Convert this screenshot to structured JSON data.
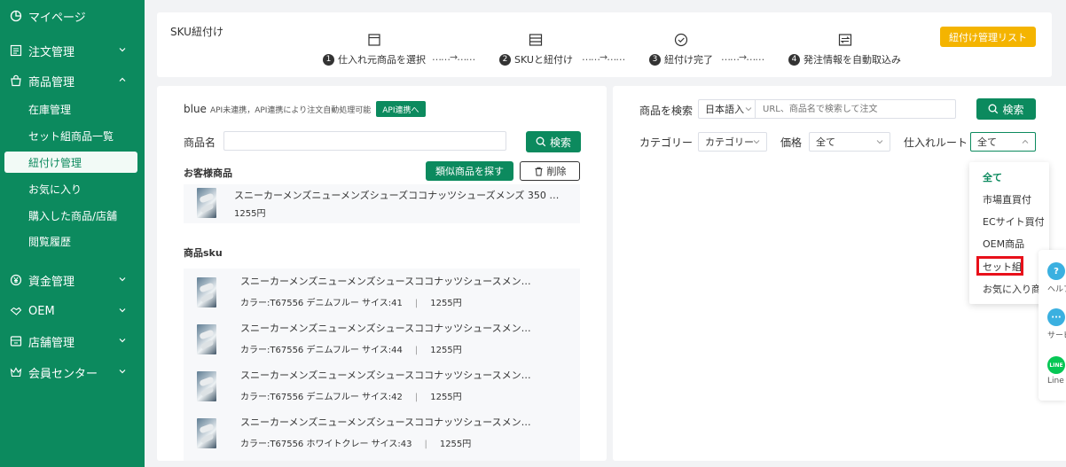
{
  "sidebar": {
    "items": [
      {
        "label": "マイページ",
        "icon": "pie-chart-icon"
      },
      {
        "label": "注文管理",
        "icon": "order-list-icon"
      },
      {
        "label": "商品管理",
        "icon": "bag-icon"
      },
      {
        "label": "資金管理",
        "icon": "yen-icon"
      },
      {
        "label": "OEM",
        "icon": "handshake-icon"
      },
      {
        "label": "店舗管理",
        "icon": "store-icon"
      },
      {
        "label": "会員センター",
        "icon": "crown-icon"
      }
    ],
    "sub_items": [
      "在庫管理",
      "セット組商品一覧",
      "紐付け管理",
      "お気に入り",
      "購入した商品/店舗",
      "閲覧履歴"
    ],
    "active_sub": "紐付け管理"
  },
  "steps": {
    "title": "SKU紐付け",
    "items": [
      {
        "num": "1",
        "label": "仕入れ元商品を選択",
        "icon": "window-icon"
      },
      {
        "num": "2",
        "label": "SKUと紐付け",
        "icon": "list-icon"
      },
      {
        "num": "3",
        "label": "紐付け完了",
        "icon": "check-circle-icon"
      },
      {
        "num": "4",
        "label": "発注情報を自動取込み",
        "icon": "transfer-icon"
      }
    ],
    "arrow": "……→……",
    "manage_button": "紐付け管理リスト"
  },
  "left": {
    "brand": "blue",
    "api_note": "API未連携，API連携により注文自動処理可能",
    "api_button": "API連携へ",
    "product_name_label": "商品名",
    "search_button": "検索",
    "customer_section": "お客様商品",
    "similar_button": "類似商品を探す",
    "delete_button": "削除",
    "customer_item": {
      "title": "スニーカーメンズニューメンズシューズココナッツシューズメンズ 350 …",
      "price": "1255円"
    },
    "sku_section": "商品sku",
    "sku_items": [
      {
        "title": "スニーカーメンズニューメンズシュースココナッツシュースメン…",
        "spec": "カラー:T67556 デニムフルー サイス:41",
        "price": "1255円"
      },
      {
        "title": "スニーカーメンズニューメンズシュースココナッツシュースメン…",
        "spec": "カラー:T67556 デニムフルー サイス:44",
        "price": "1255円"
      },
      {
        "title": "スニーカーメンズニューメンズシュースココナッツシュースメン…",
        "spec": "カラー:T67556 デニムフルー サイス:42",
        "price": "1255円"
      },
      {
        "title": "スニーカーメンズニューメンズシュースココナッツシュースメン…",
        "spec": "カラー:T67556 ホワイトクレー サイス:43",
        "price": "1255円"
      }
    ]
  },
  "right": {
    "search_label": "商品を検索",
    "lang_select": "日本語入",
    "search_placeholder": "URL、商品名で検索して注文",
    "search_button": "検索",
    "category_label": "カテゴリー",
    "category_select": "カテゴリー",
    "price_label": "価格",
    "price_select": "全て",
    "route_label": "仕入れルート",
    "route_select": "全て",
    "dropdown_options": [
      "全て",
      "市場直買付",
      "ECサイト買付",
      "OEM商品",
      "セット組",
      "お気に入り商"
    ],
    "selected_option": "全て",
    "highlighted_option": "セット組"
  },
  "float_tools": [
    {
      "label": "ヘルプ",
      "icon": "help-icon",
      "color": "#3bb0e0"
    },
    {
      "label": "サービス",
      "icon": "chat-icon",
      "color": "#3bb0e0"
    },
    {
      "label": "Line",
      "icon": "line-icon",
      "color": "#06c755"
    }
  ],
  "colors": {
    "primary": "#0c8a5e",
    "accent": "#f4b400",
    "highlight": "#e8101a"
  }
}
